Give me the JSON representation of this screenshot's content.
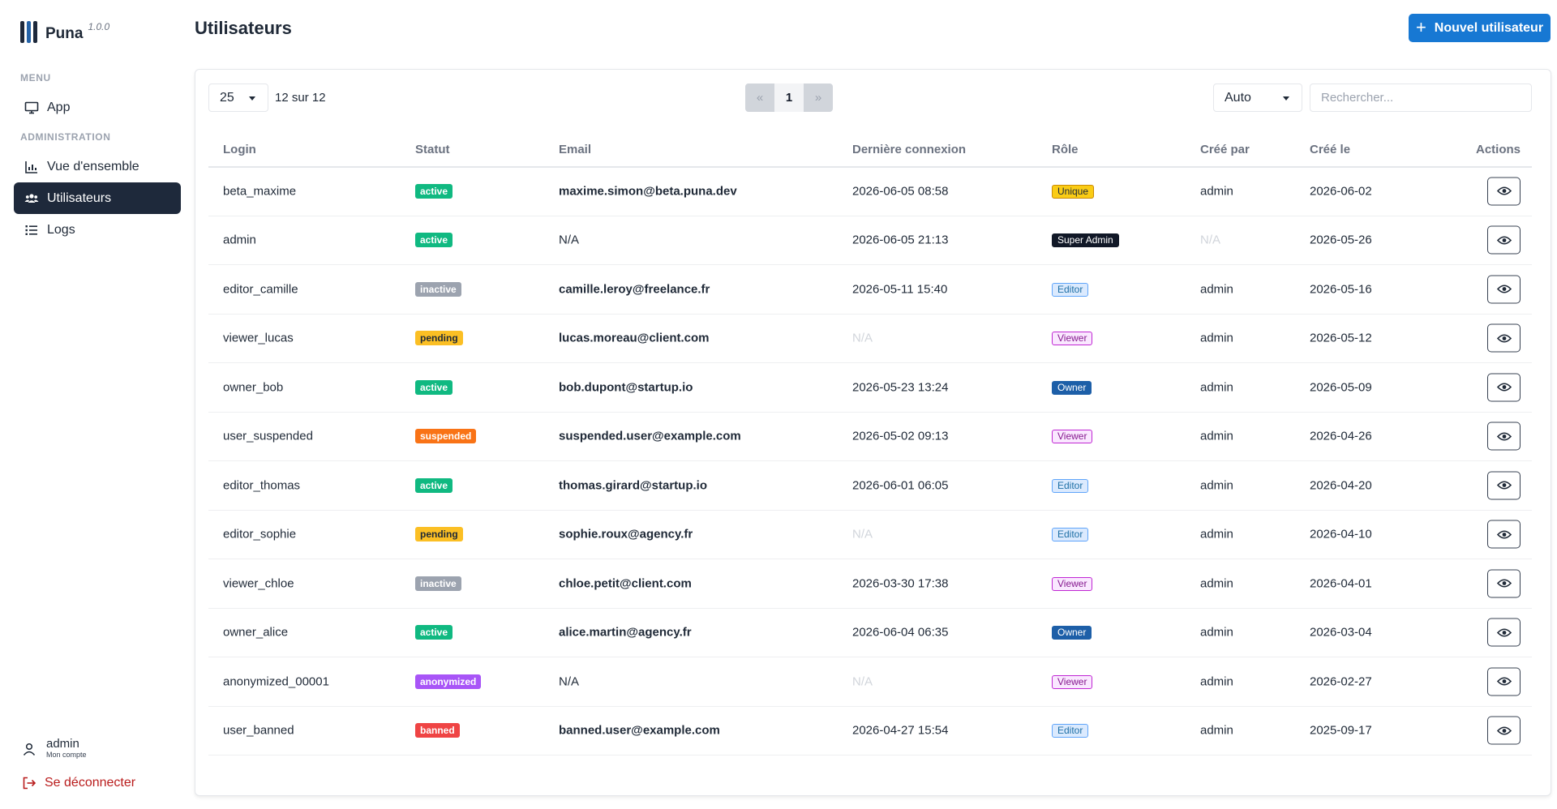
{
  "app": {
    "name": "Puna",
    "version": "1.0.0"
  },
  "sidebar": {
    "menu_label": "MENU",
    "admin_label": "ADMINISTRATION",
    "items": [
      {
        "label": "App",
        "icon": "monitor-icon"
      },
      {
        "label": "Vue d'ensemble",
        "icon": "chart-icon"
      },
      {
        "label": "Utilisateurs",
        "icon": "users-icon",
        "active": true
      },
      {
        "label": "Logs",
        "icon": "list-icon"
      }
    ],
    "account": {
      "name": "admin",
      "subtitle": "Mon compte"
    },
    "logout_label": "Se déconnecter"
  },
  "header": {
    "title": "Utilisateurs",
    "new_button": "Nouvel utilisateur",
    "accent": "#1778d3"
  },
  "toolbar": {
    "per_page": "25",
    "count_text": "12 sur 12",
    "pager": {
      "prev": "«",
      "page": "1",
      "next": "»"
    },
    "density": "Auto",
    "search_placeholder": "Rechercher..."
  },
  "table": {
    "columns": [
      "Login",
      "Statut",
      "Email",
      "Dernière connexion",
      "Rôle",
      "Créé par",
      "Créé le",
      "Actions"
    ],
    "rows": [
      {
        "login": "beta_maxime",
        "status": "active",
        "email": "maxime.simon@beta.puna.dev",
        "last": "2026-06-05 08:58",
        "role": "Unique",
        "by": "admin",
        "created": "2026-06-02"
      },
      {
        "login": "admin",
        "status": "active",
        "email": "N/A",
        "last": "2026-06-05 21:13",
        "role": "Super Admin",
        "by": "N/A",
        "created": "2026-05-26"
      },
      {
        "login": "editor_camille",
        "status": "inactive",
        "email": "camille.leroy@freelance.fr",
        "last": "2026-05-11 15:40",
        "role": "Editor",
        "by": "admin",
        "created": "2026-05-16"
      },
      {
        "login": "viewer_lucas",
        "status": "pending",
        "email": "lucas.moreau@client.com",
        "last": "N/A",
        "role": "Viewer",
        "by": "admin",
        "created": "2026-05-12"
      },
      {
        "login": "owner_bob",
        "status": "active",
        "email": "bob.dupont@startup.io",
        "last": "2026-05-23 13:24",
        "role": "Owner",
        "by": "admin",
        "created": "2026-05-09"
      },
      {
        "login": "user_suspended",
        "status": "suspended",
        "email": "suspended.user@example.com",
        "last": "2026-05-02 09:13",
        "role": "Viewer",
        "by": "admin",
        "created": "2026-04-26"
      },
      {
        "login": "editor_thomas",
        "status": "active",
        "email": "thomas.girard@startup.io",
        "last": "2026-06-01 06:05",
        "role": "Editor",
        "by": "admin",
        "created": "2026-04-20"
      },
      {
        "login": "editor_sophie",
        "status": "pending",
        "email": "sophie.roux@agency.fr",
        "last": "N/A",
        "role": "Editor",
        "by": "admin",
        "created": "2026-04-10"
      },
      {
        "login": "viewer_chloe",
        "status": "inactive",
        "email": "chloe.petit@client.com",
        "last": "2026-03-30 17:38",
        "role": "Viewer",
        "by": "admin",
        "created": "2026-04-01"
      },
      {
        "login": "owner_alice",
        "status": "active",
        "email": "alice.martin@agency.fr",
        "last": "2026-06-04 06:35",
        "role": "Owner",
        "by": "admin",
        "created": "2026-03-04"
      },
      {
        "login": "anonymized_00001",
        "status": "anonymized",
        "email": "N/A",
        "last": "N/A",
        "role": "Viewer",
        "by": "admin",
        "created": "2026-02-27"
      },
      {
        "login": "user_banned",
        "status": "banned",
        "email": "banned.user@example.com",
        "last": "2026-04-27 15:54",
        "role": "Editor",
        "by": "admin",
        "created": "2025-09-17"
      }
    ]
  },
  "status_colors": {
    "active": "#10b981",
    "inactive": "#9ca3af",
    "pending": "#fbbf24",
    "suspended": "#f97316",
    "anonymized": "#a855f7",
    "banned": "#ef4444"
  },
  "role_styles": {
    "Unique": {
      "bg": "#facc15",
      "fg": "#1f2937",
      "border": "#ca8a04"
    },
    "Super Admin": {
      "bg": "#111827",
      "fg": "#ffffff",
      "border": "#111827"
    },
    "Editor": {
      "bg": "#dbeafe",
      "fg": "#1d6fa5",
      "border": "#60a5fa"
    },
    "Viewer": {
      "bg": "#fae8ff",
      "fg": "#86198f",
      "border": "#c026d3"
    },
    "Owner": {
      "bg": "#1d5fa8",
      "fg": "#ffffff",
      "border": "#1d5fa8"
    }
  }
}
